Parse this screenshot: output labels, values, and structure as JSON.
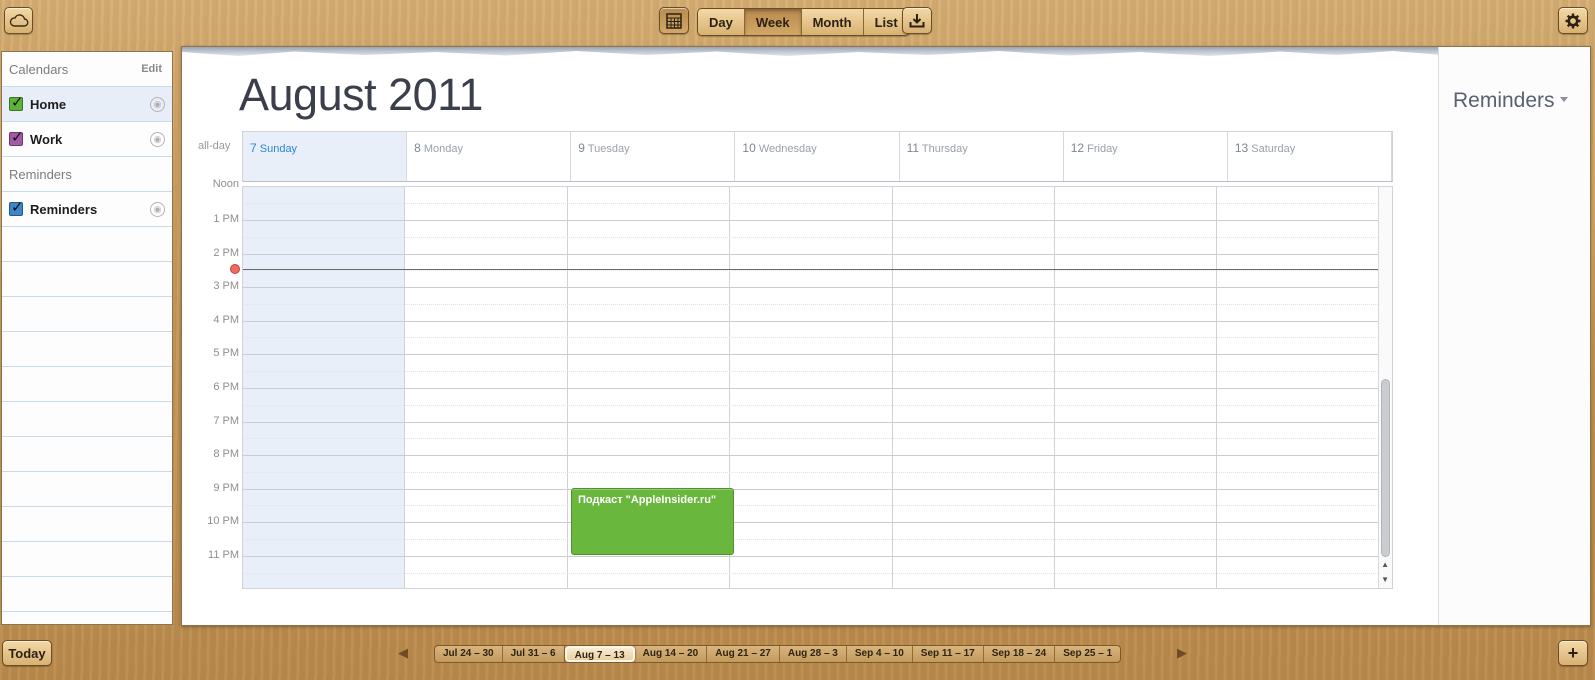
{
  "toolbar": {
    "cloud_icon": "cloud-icon",
    "minical_icon": "calendar-grid-icon",
    "views": [
      "Day",
      "Week",
      "Month",
      "List"
    ],
    "active_view": "Week",
    "download_icon": "download-tray-icon",
    "settings_icon": "gear-icon"
  },
  "sidebar": {
    "calendars_header": "Calendars",
    "edit_label": "Edit",
    "calendars": [
      {
        "label": "Home",
        "color": "#5db33a",
        "checked": true,
        "selected": true
      },
      {
        "label": "Work",
        "color": "#a35aa6",
        "checked": true,
        "selected": false
      }
    ],
    "reminders_header": "Reminders",
    "reminder_lists": [
      {
        "label": "Reminders",
        "color": "#3f86c9",
        "checked": true
      }
    ]
  },
  "main": {
    "title": "August 2011",
    "allday_label": "all-day",
    "days": [
      {
        "num": "7",
        "name": "Sunday",
        "today": true
      },
      {
        "num": "8",
        "name": "Monday",
        "today": false
      },
      {
        "num": "9",
        "name": "Tuesday",
        "today": false
      },
      {
        "num": "10",
        "name": "Wednesday",
        "today": false
      },
      {
        "num": "11",
        "name": "Thursday",
        "today": false
      },
      {
        "num": "12",
        "name": "Friday",
        "today": false
      },
      {
        "num": "13",
        "name": "Saturday",
        "today": false
      }
    ],
    "partial_label": "Noon",
    "hours": [
      "1 PM",
      "2 PM",
      "3 PM",
      "4 PM",
      "5 PM",
      "6 PM",
      "7 PM",
      "8 PM",
      "9 PM",
      "10 PM",
      "11 PM"
    ],
    "event": {
      "title": "Подкаст \"AppleInsider.ru\"",
      "day": "9 Tuesday",
      "start": "9 PM",
      "end": "11 PM",
      "color": "#6ab73e"
    }
  },
  "reminders_panel": {
    "title": "Reminders"
  },
  "bottom": {
    "today_label": "Today",
    "weeks": [
      "Jul 24 – 30",
      "Jul 31 – 6",
      "Aug 7 – 13",
      "Aug 14 – 20",
      "Aug 21 – 27",
      "Aug 28 – 3",
      "Sep 4 – 10",
      "Sep 11 – 17",
      "Sep 18 – 24",
      "Sep 25 – 1"
    ],
    "active_week": "Aug 7 – 13",
    "add_label": "+"
  }
}
